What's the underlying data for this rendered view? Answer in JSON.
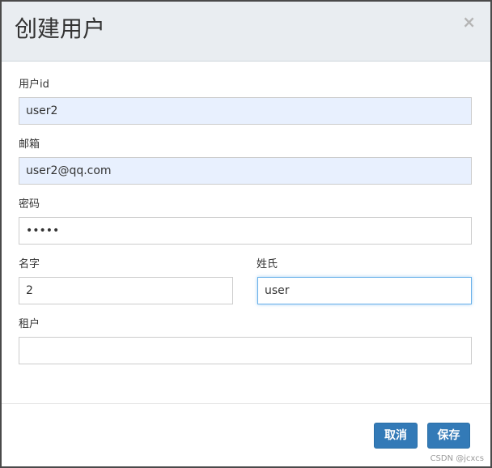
{
  "dialog": {
    "title": "创建用户",
    "close_glyph": "×"
  },
  "form": {
    "user_id": {
      "label": "用户id",
      "value": "user2"
    },
    "email": {
      "label": "邮箱",
      "value": "user2@qq.com"
    },
    "password": {
      "label": "密码",
      "value": "•••••"
    },
    "first_name": {
      "label": "名字",
      "value": "2"
    },
    "last_name": {
      "label": "姓氏",
      "value": "user"
    },
    "tenant": {
      "label": "租户",
      "value": ""
    }
  },
  "footer": {
    "cancel_label": "取消",
    "save_label": "保存"
  },
  "watermark": "CSDN @jcxcs",
  "colors": {
    "primary": "#337ab7",
    "header_bg": "#e9edf1",
    "autofill_bg": "#e8f0fe",
    "focus_border": "#66afe9"
  }
}
